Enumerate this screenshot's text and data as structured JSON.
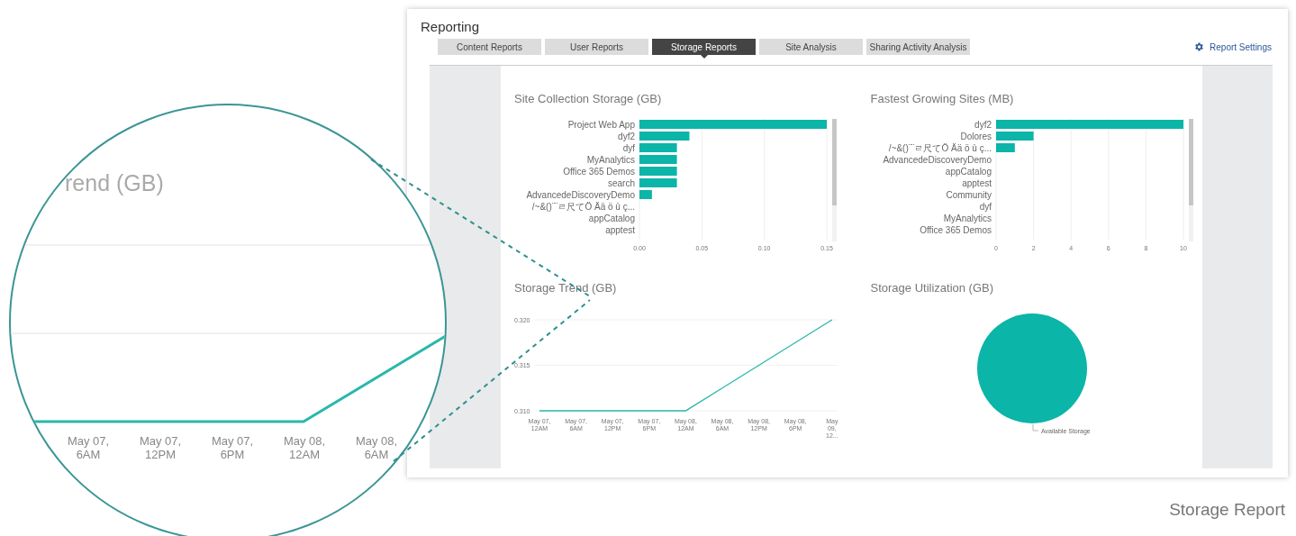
{
  "window": {
    "title": "Reporting"
  },
  "tabs": [
    {
      "label": "Content Reports",
      "selected": false
    },
    {
      "label": "User Reports",
      "selected": false
    },
    {
      "label": "Storage Reports",
      "selected": true
    },
    {
      "label": "Site Analysis",
      "selected": false
    },
    {
      "label": "Sharing Activity Analysis",
      "selected": false
    }
  ],
  "settings_link": {
    "label": "Report Settings"
  },
  "charts": [
    {
      "chart_data": {
        "type": "bar",
        "orientation": "horizontal",
        "title": "Site Collection Storage (GB)",
        "categories": [
          "Project Web App",
          "dyf2",
          "dyf",
          "MyAnalytics",
          "Office 365 Demos",
          "search",
          "AdvancedeDiscoveryDemo",
          "/~&()¨¨ㄹ尺てÖ Ää ö ù ç...",
          "appCatalog",
          "apptest"
        ],
        "series": [
          {
            "color": "#0bb5a8",
            "values": [
              0.15,
              0.04,
              0.03,
              0.03,
              0.03,
              0.03,
              0.01,
              0,
              0,
              0
            ]
          }
        ],
        "grid": true,
        "xlim": [
          0,
          0.15
        ],
        "xticks": [
          {
            "value": 0,
            "label": "0.00"
          },
          {
            "value": 0.05,
            "label": "0.05"
          },
          {
            "value": 0.1,
            "label": "0.10"
          },
          {
            "value": 0.15,
            "label": "0.15"
          }
        ]
      }
    },
    {
      "chart_data": {
        "type": "bar",
        "orientation": "horizontal",
        "title": "Fastest Growing Sites (MB)",
        "categories": [
          "dyf2",
          "Dolores",
          "/~&()¨¨ㄹ尺てÖ Ää ö ù ç...",
          "AdvancedeDiscoveryDemo",
          "appCatalog",
          "apptest",
          "Community",
          "dyf",
          "MyAnalytics",
          "Office 365 Demos"
        ],
        "series": [
          {
            "color": "#0bb5a8",
            "values": [
              10,
              2,
              1,
              0,
              0,
              0,
              0,
              0,
              0,
              0
            ]
          }
        ],
        "grid": true,
        "xlim": [
          0,
          10
        ],
        "xticks": [
          0,
          2,
          4,
          6,
          8,
          10
        ]
      }
    },
    {
      "chart_data": {
        "type": "line",
        "title": "Storage Trend (GB)",
        "x": [
          "May 07, 12AM",
          "May 07, 6AM",
          "May 07, 12PM",
          "May 07, 6PM",
          "May 08, 12AM",
          "May 08, 6AM",
          "May 08, 12PM",
          "May 08, 6PM",
          "May 09, 12..."
        ],
        "series": [
          {
            "color": "#2ab7ab",
            "values": [
              0.31,
              0.31,
              0.31,
              0.31,
              0.31,
              0.3125,
              0.315,
              0.3175,
              0.32
            ]
          }
        ],
        "grid": true,
        "ylim": [
          0.31,
          0.32
        ],
        "yticks": [
          {
            "value": 0.31,
            "label": "0.310"
          },
          {
            "value": 0.315,
            "label": "0.315"
          },
          {
            "value": 0.32,
            "label": "0.320"
          }
        ]
      }
    },
    {
      "chart_data": {
        "type": "pie",
        "title": "Storage Utilization (GB)",
        "categories": [
          "Available Storage"
        ],
        "series": [
          {
            "color": "#0bb5a8",
            "values": [
              1
            ]
          }
        ]
      }
    }
  ],
  "magnifier": {
    "title": "rend (GB)",
    "x_labels": [
      "May 07, 6AM",
      "May 07, 12PM",
      "May 07, 6PM",
      "May 08, 12AM",
      "May 08, 6AM"
    ]
  },
  "caption": "Storage Report"
}
